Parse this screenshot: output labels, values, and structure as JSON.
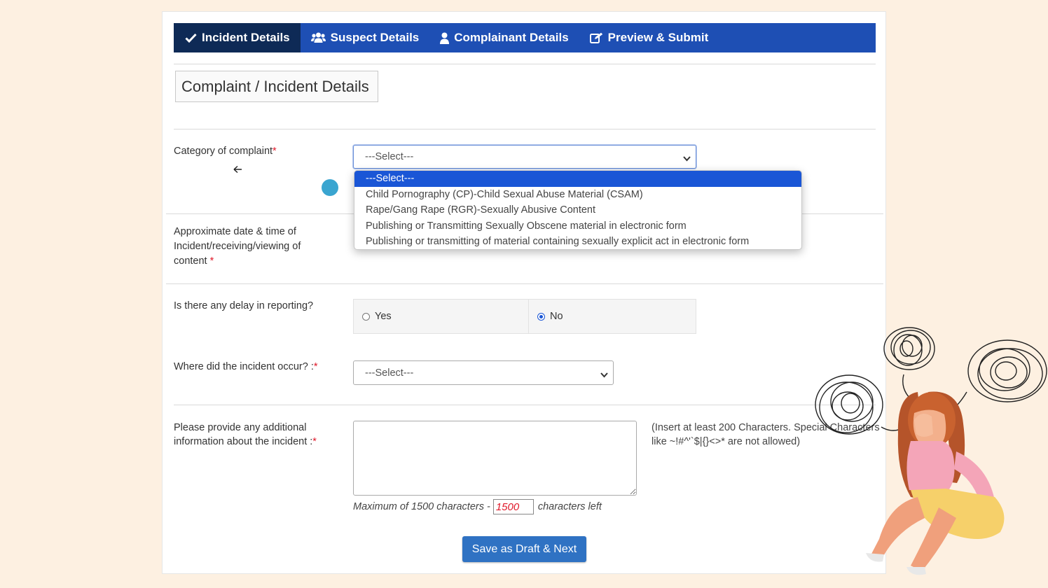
{
  "tabs": [
    {
      "label": "Incident Details",
      "icon": "check-icon",
      "active": true
    },
    {
      "label": "Suspect Details",
      "icon": "users-icon",
      "active": false
    },
    {
      "label": "Complainant Details",
      "icon": "user-icon",
      "active": false
    },
    {
      "label": "Preview & Submit",
      "icon": "edit-icon",
      "active": false
    }
  ],
  "section_title": "Complaint / Incident Details",
  "category": {
    "label": "Category of complaint",
    "required_mark": "*",
    "selected": "---Select---",
    "options": [
      "---Select---",
      "Child Pornography (CP)-Child Sexual Abuse Material (CSAM)",
      "Rape/Gang Rape (RGR)-Sexually Abusive Content",
      "Publishing or Transmitting Sexually Obscene material in electronic form",
      "Publishing or transmitting of material containing sexually explicit act in electronic form"
    ]
  },
  "datetime": {
    "label": "Approximate date & time of Incident/receiving/viewing of content",
    "required_mark": "*"
  },
  "delay": {
    "label": "Is there any delay in reporting?",
    "yes_label": "Yes",
    "no_label": "No",
    "selected": "No"
  },
  "location": {
    "label": "Where did the incident occur? :",
    "required_mark": "*",
    "selected": "---Select---"
  },
  "additional_info": {
    "label": "Please provide any additional information about the incident :",
    "required_mark": "*",
    "hint": "(Insert at least 200 Characters. Special Characters like ~!#^'`$|{}<>* are not allowed)",
    "max_prefix": "Maximum of 1500 characters -",
    "remaining": "1500",
    "max_suffix": "characters left"
  },
  "submit_label": "Save as Draft & Next",
  "colors": {
    "tabbar": "#1e4fb4",
    "tab_active": "#0e2a56",
    "button": "#2f72c3",
    "required": "#e0192a",
    "page_background": "#fdf0e1"
  }
}
